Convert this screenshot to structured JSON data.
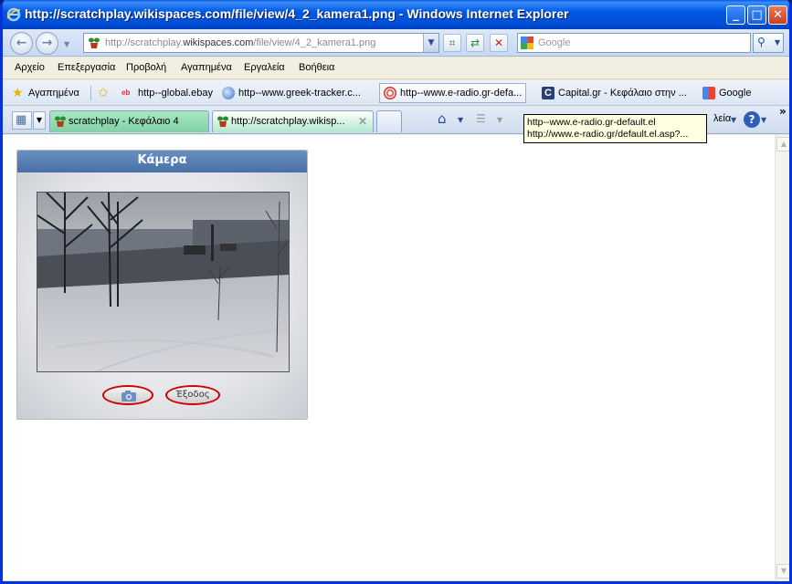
{
  "window": {
    "title": "http://scratchplay.wikispaces.com/file/view/4_2_kamera1.png - Windows Internet Explorer"
  },
  "addressbar": {
    "url_prefix": "http://scratchplay.",
    "url_domain": "wikispaces.com",
    "url_path": "/file/view/4_2_kamera1.png",
    "search_placeholder": "Google"
  },
  "menubar": {
    "items": [
      "Αρχείο",
      "Επεξεργασία",
      "Προβολή",
      "Αγαπημένα",
      "Εργαλεία",
      "Βοήθεια"
    ]
  },
  "favorites": {
    "label": "Αγαπημένα",
    "items": [
      {
        "label": "http--global.ebay",
        "icon": "ebay-icon"
      },
      {
        "label": "http--www.greek-tracker.c...",
        "icon": "globe-icon"
      },
      {
        "label": "http--www.e-radio.gr-defa...",
        "icon": "eradio-icon"
      },
      {
        "label": "Capital.gr - Κεφάλαιο στην ...",
        "icon": "capital-icon"
      },
      {
        "label": "Google",
        "icon": "google-icon"
      }
    ]
  },
  "tabs": {
    "items": [
      {
        "label": "scratchplay - Κεφάλαιο 4"
      },
      {
        "label": "http://scratchplay.wikisp..."
      }
    ],
    "tools_label": "λεία"
  },
  "tooltip": {
    "line1": "http--www.e-radio.gr-default.el",
    "line2": "http://www.e-radio.gr/default.el.asp?..."
  },
  "page": {
    "panel_title": "Κάμερα",
    "back_button": "Έξοδος"
  },
  "colors": {
    "titlebar": "#0058e6",
    "panel_header": "#5a81b5",
    "button_outline": "#cc0000",
    "tab_active": "#b2e8cb"
  }
}
